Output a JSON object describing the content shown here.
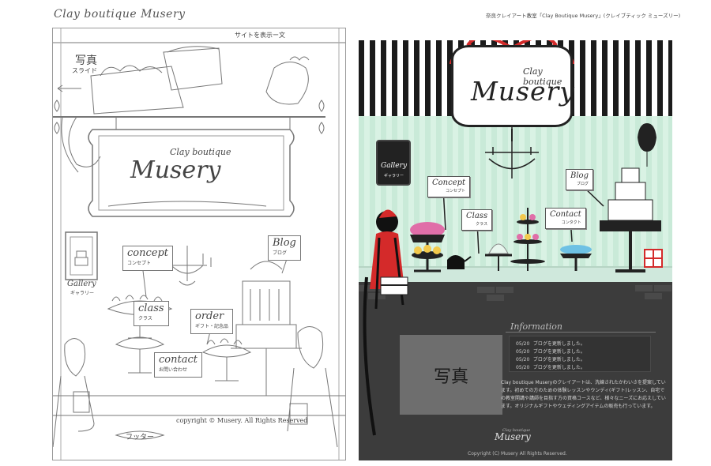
{
  "sketch": {
    "title": "Clay boutique Musery",
    "note_top": "サイトを表示ー文",
    "photo_label": "写真",
    "slide_label": "スライド",
    "logo_small": "Clay boutique",
    "logo_big": "Musery",
    "gallery_label": "Gallery",
    "gallery_sub": "ギャラリー",
    "labels": [
      {
        "text": "concept",
        "sub": "コンセプト"
      },
      {
        "text": "Blog",
        "sub": "ブログ"
      },
      {
        "text": "class",
        "sub": "クラス"
      },
      {
        "text": "order",
        "sub": "ギフト・記念品"
      },
      {
        "text": "contact",
        "sub": "お問い合わせ"
      }
    ],
    "copyright": "copyright © Musery. All Rights Reserved",
    "footer_label": "フッター"
  },
  "final": {
    "caption": "奈良クレイアート教室「Clay Boutique Musery」(クレイブティック ミューズリー)",
    "logo_small": "Clay boutique",
    "logo_big": "Musery",
    "gallery_label": "Gallery",
    "gallery_sub": "ギャラリー",
    "nav": {
      "concept": {
        "label": "Concept",
        "sub": "コンセプト"
      },
      "class": {
        "label": "Class",
        "sub": "クラス"
      },
      "contact": {
        "label": "Contact",
        "sub": "コンタクト"
      },
      "blog": {
        "label": "Blog",
        "sub": "ブログ"
      }
    },
    "photo_label": "写真",
    "information_title": "Information",
    "news": [
      {
        "date": "05/20",
        "text": "ブログを更新しました。"
      },
      {
        "date": "05/20",
        "text": "ブログを更新しました。"
      },
      {
        "date": "05/20",
        "text": "ブログを更新しました。"
      },
      {
        "date": "05/20",
        "text": "ブログを更新しました。"
      }
    ],
    "description": "Clay boutique Museryのクレイアートは、洗練されたかわいさを提案しています。初めての方のための体験レッスンやウンディ(ギフト)レッスン、自宅での教室開講や講師を目指す方の資格コースなど、様々なニーズにお応えしています。オリジナルギフトやウェディングアイテムの販売も行っています。",
    "footer_logo_small": "Clay boutique",
    "footer_logo": "Musery",
    "copyright": "Copyright (C) Musery All Rights Reserved.",
    "colors": {
      "stripe_dark": "#1b1b1b",
      "mint": "#c9ead8",
      "ribbon_red": "#d42a2a",
      "floor": "#3c3c3c",
      "photo_box": "#6e6e6e"
    }
  }
}
